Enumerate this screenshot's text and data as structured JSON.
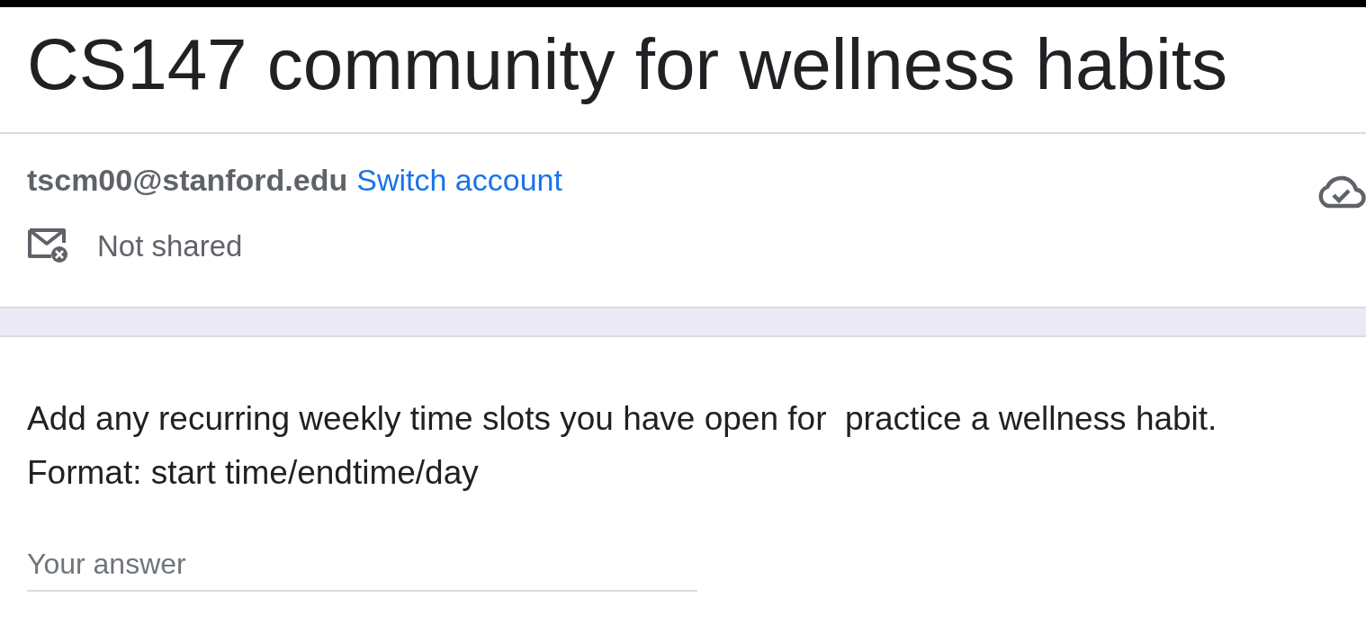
{
  "form": {
    "title": "CS147 community for wellness habits"
  },
  "account": {
    "email": "tscm00@stanford.edu",
    "switch_link": "Switch account",
    "sharing": "Not shared"
  },
  "question": {
    "lines": [
      "Add any recurring weekly time slots you have open for  practice a wellness habit.",
      "Format: start time/endtime/day"
    ],
    "answer": {
      "placeholder": "Your answer"
    }
  }
}
